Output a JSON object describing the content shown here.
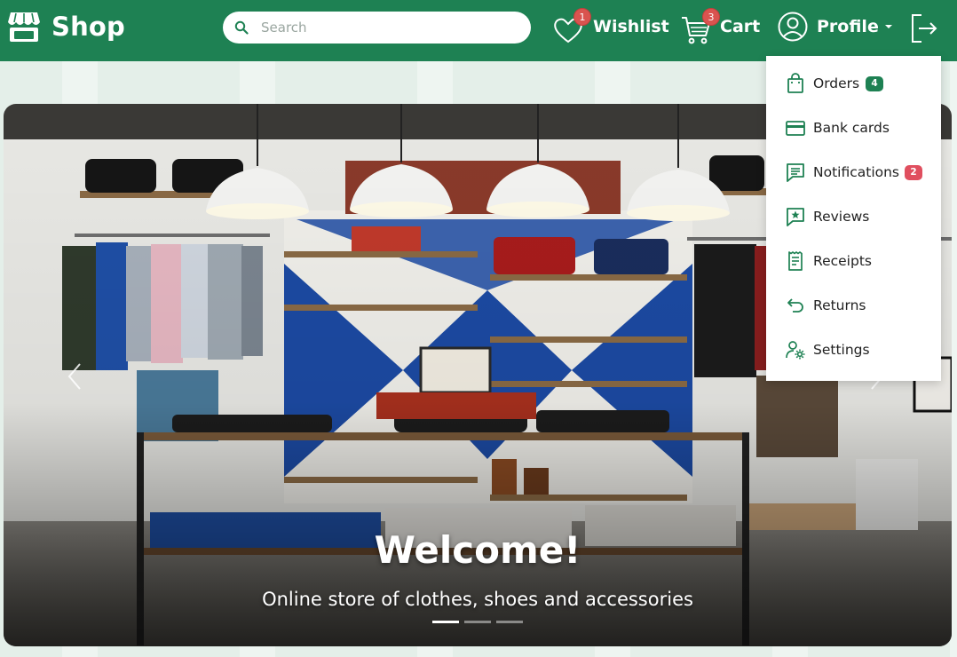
{
  "brand": {
    "name": "Shop",
    "icon": "storefront-icon"
  },
  "search": {
    "placeholder": "Search",
    "value": "",
    "icon": "search-icon"
  },
  "nav": {
    "wishlist": {
      "label": "Wishlist",
      "badge": "1",
      "icon": "heart-icon"
    },
    "cart": {
      "label": "Cart",
      "badge": "3",
      "icon": "cart-icon"
    },
    "profile": {
      "label": "Profile",
      "icon": "user-circle-icon",
      "caret_icon": "caret-down-icon"
    },
    "logout": {
      "icon": "logout-icon"
    }
  },
  "profile_menu": {
    "items": [
      {
        "label": "Orders",
        "icon": "shopping-bag-icon",
        "badge": "4",
        "badge_color": "#1e8153"
      },
      {
        "label": "Bank cards",
        "icon": "credit-card-icon"
      },
      {
        "label": "Notifications",
        "icon": "message-icon",
        "badge": "2",
        "badge_color": "#e04f5f"
      },
      {
        "label": "Reviews",
        "icon": "review-star-icon"
      },
      {
        "label": "Receipts",
        "icon": "receipt-icon"
      },
      {
        "label": "Returns",
        "icon": "return-arrow-icon"
      },
      {
        "label": "Settings",
        "icon": "user-settings-icon"
      }
    ]
  },
  "hero": {
    "title": "Welcome!",
    "subtitle": "Online store of clothes, shoes and accessories",
    "slides_total": 3,
    "active_slide": 1,
    "prev_icon": "chevron-left-icon",
    "next_icon": "chevron-right-icon",
    "image": "clothing-store-interior-photo"
  },
  "colors": {
    "header": "#1e8153",
    "accent": "#1e8153",
    "badge_red": "#d9534f",
    "page_bg": "#e4efe9"
  }
}
